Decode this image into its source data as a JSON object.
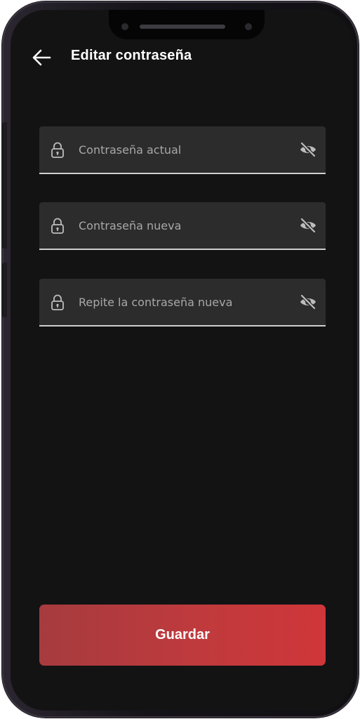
{
  "header": {
    "title": "Editar contraseña"
  },
  "fields": [
    {
      "placeholder": "Contraseña actual",
      "value": ""
    },
    {
      "placeholder": "Contraseña nueva",
      "value": ""
    },
    {
      "placeholder": "Repite la contraseña nueva",
      "value": ""
    }
  ],
  "actions": {
    "save_label": "Guardar"
  },
  "icons": {
    "back": "arrow-left-icon",
    "field_leading": "lock-icon",
    "field_trailing": "eye-off-icon"
  },
  "colors": {
    "background": "#141314",
    "field_background": "#2d2c2d",
    "field_underline": "#cfcfcf",
    "accent_start": "#a63b3e",
    "accent_end": "#cf3639",
    "text_primary": "#ffffff",
    "placeholder": "#a8a8a8"
  }
}
